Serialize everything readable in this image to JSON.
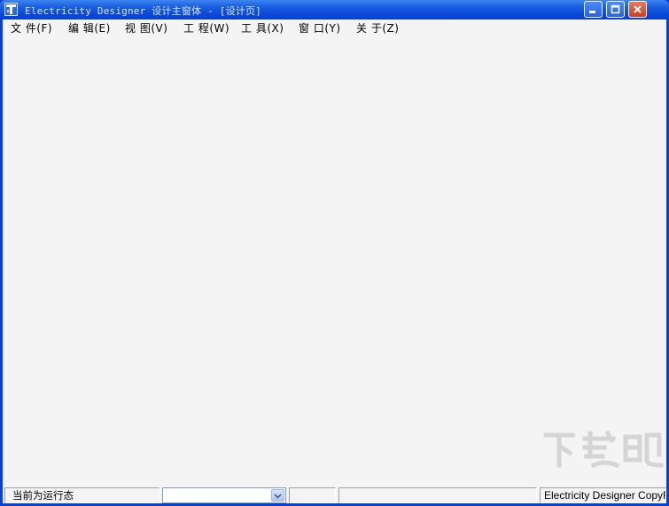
{
  "window": {
    "title": "Electricity Designer 设计主窗体 - [设计页]"
  },
  "menu": {
    "items": [
      {
        "label": "文 件(F)"
      },
      {
        "label": "编 辑(E)"
      },
      {
        "label": "视 图(V)"
      },
      {
        "label": "工 程(W)"
      },
      {
        "label": "工 具(X)"
      },
      {
        "label": "窗 口(Y)"
      },
      {
        "label": "关 于(Z)"
      }
    ]
  },
  "status": {
    "run_state": "当前为运行态",
    "combo_value": "",
    "panel3": "",
    "panel4": "",
    "copyright": "Electricity Designer CopyRight"
  },
  "watermark": {
    "text": "下载吧"
  },
  "colors": {
    "titlebar": "#0b4ad8",
    "client_bg": "#f4f4f4",
    "close_button": "#c8401f"
  },
  "icons": {
    "app": "app-icon",
    "minimize": "minimize-icon",
    "maximize": "maximize-icon",
    "close": "close-icon",
    "combo_dropdown": "chevron-down-icon"
  }
}
